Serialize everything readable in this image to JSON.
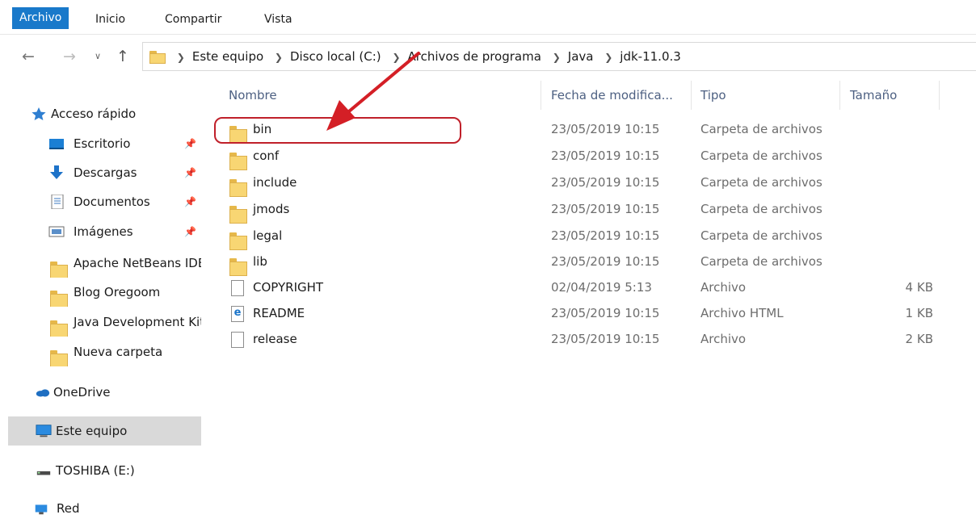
{
  "ribbon": {
    "tabs": [
      "Archivo",
      "Inicio",
      "Compartir",
      "Vista"
    ]
  },
  "address": {
    "crumbs": [
      "Este equipo",
      "Disco local (C:)",
      "Archivos de programa",
      "Java",
      "jdk-11.0.3"
    ]
  },
  "sidebar": {
    "quick_access": "Acceso rápido",
    "pinned": [
      "Escritorio",
      "Descargas",
      "Documentos",
      "Imágenes"
    ],
    "folders": [
      "Apache NetBeans IDE",
      "Blog Oregoom",
      "Java Development Kit",
      "Nueva carpeta"
    ],
    "onedrive": "OneDrive",
    "this_pc": "Este equipo",
    "drive": "TOSHIBA (E:)",
    "network": "Red"
  },
  "columns": {
    "name": "Nombre",
    "date": "Fecha de modifica...",
    "type": "Tipo",
    "size": "Tamaño"
  },
  "files": [
    {
      "name": "bin",
      "date": "23/05/2019 10:15",
      "type": "Carpeta de archivos",
      "size": "",
      "icon": "folder-icon"
    },
    {
      "name": "conf",
      "date": "23/05/2019 10:15",
      "type": "Carpeta de archivos",
      "size": "",
      "icon": "folder-icon"
    },
    {
      "name": "include",
      "date": "23/05/2019 10:15",
      "type": "Carpeta de archivos",
      "size": "",
      "icon": "folder-icon"
    },
    {
      "name": "jmods",
      "date": "23/05/2019 10:15",
      "type": "Carpeta de archivos",
      "size": "",
      "icon": "folder-icon"
    },
    {
      "name": "legal",
      "date": "23/05/2019 10:15",
      "type": "Carpeta de archivos",
      "size": "",
      "icon": "folder-icon"
    },
    {
      "name": "lib",
      "date": "23/05/2019 10:15",
      "type": "Carpeta de archivos",
      "size": "",
      "icon": "folder-icon"
    },
    {
      "name": "COPYRIGHT",
      "date": "02/04/2019 5:13",
      "type": "Archivo",
      "size": "4 KB",
      "icon": "file-icon"
    },
    {
      "name": "README",
      "date": "23/05/2019 10:15",
      "type": "Archivo HTML",
      "size": "1 KB",
      "icon": "html-file-icon"
    },
    {
      "name": "release",
      "date": "23/05/2019 10:15",
      "type": "Archivo",
      "size": "2 KB",
      "icon": "file-icon"
    }
  ],
  "colors": {
    "accent": "#1979ca",
    "highlight": "#c0202a",
    "selected_nav": "#d9d9d9",
    "folder": "#f8d673"
  }
}
